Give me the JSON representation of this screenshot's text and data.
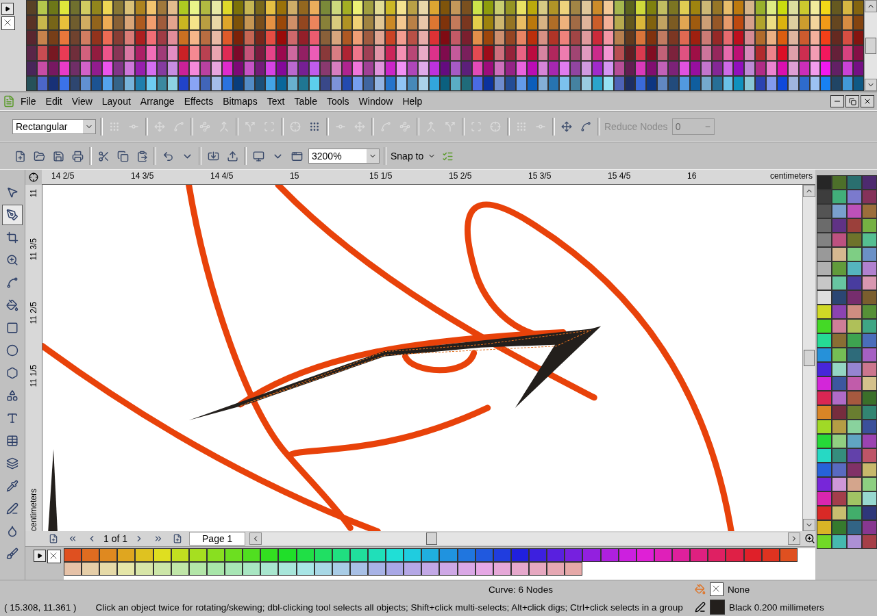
{
  "menu": {
    "items": [
      "File",
      "Edit",
      "View",
      "Layout",
      "Arrange",
      "Effects",
      "Bitmaps",
      "Text",
      "Table",
      "Tools",
      "Window",
      "Help"
    ]
  },
  "property_bar": {
    "mode": "Rectangular",
    "node_buttons": [
      {
        "disabled": true
      },
      {
        "disabled": true
      },
      {
        "disabled": true
      },
      {
        "disabled": true
      },
      {
        "disabled": true
      },
      {
        "disabled": true
      },
      {
        "disabled": true
      },
      {
        "disabled": true
      },
      {
        "disabled": true
      },
      {
        "disabled": false
      },
      {
        "disabled": true
      },
      {
        "disabled": true
      },
      {
        "disabled": true
      },
      {
        "disabled": true
      },
      {
        "disabled": true
      },
      {
        "disabled": true
      },
      {
        "disabled": true
      },
      {
        "disabled": true
      },
      {
        "disabled": true
      },
      {
        "disabled": true
      },
      {
        "disabled": false
      },
      {
        "disabled": false
      }
    ],
    "reduce_label": "Reduce Nodes",
    "reduce_value": "0",
    "reduce_disabled": true
  },
  "standard_bar": {
    "zoom": "3200%",
    "snap_label": "Snap to"
  },
  "ruler": {
    "horizontal": [
      "14 2/5",
      "14 3/5",
      "14 4/5",
      "15",
      "15 1/5",
      "15 2/5",
      "15 3/5",
      "15 4/5",
      "16"
    ],
    "horizontal_unit": "centimeters",
    "vertical": [
      "11",
      "11 3/5",
      "11 2/5",
      "11 1/5"
    ],
    "vertical_unit": "centimeters"
  },
  "toolbox": [
    {
      "kind": "pick",
      "selected": false
    },
    {
      "kind": "shape",
      "selected": true
    },
    {
      "kind": "crop",
      "selected": false
    },
    {
      "kind": "zoom",
      "selected": false
    },
    {
      "kind": "curve",
      "selected": false
    },
    {
      "kind": "smartfill",
      "selected": false
    },
    {
      "kind": "rectangle",
      "selected": false
    },
    {
      "kind": "ellipse",
      "selected": false
    },
    {
      "kind": "polygon",
      "selected": false
    },
    {
      "kind": "shapes",
      "selected": false
    },
    {
      "kind": "text",
      "selected": false
    },
    {
      "kind": "table",
      "selected": false
    },
    {
      "kind": "blend",
      "selected": false
    },
    {
      "kind": "eyedropper",
      "selected": false
    },
    {
      "kind": "outline",
      "selected": false
    },
    {
      "kind": "fill",
      "selected": false
    },
    {
      "kind": "interactive",
      "selected": false
    }
  ],
  "page_nav": {
    "count": "1 of 1",
    "tabs": [
      {
        "label": "Page 1",
        "selected": true
      }
    ]
  },
  "status_bar": {
    "object": "Curve: 6 Nodes",
    "coords": "( 15.308, 11.361 )",
    "hint": "Click an object twice for rotating/skewing; dbl-clicking tool selects all objects; Shift+click multi-selects; Alt+click digs; Ctrl+click selects in a group",
    "fill": "None",
    "outline": "Black  0.200 millimeters"
  }
}
